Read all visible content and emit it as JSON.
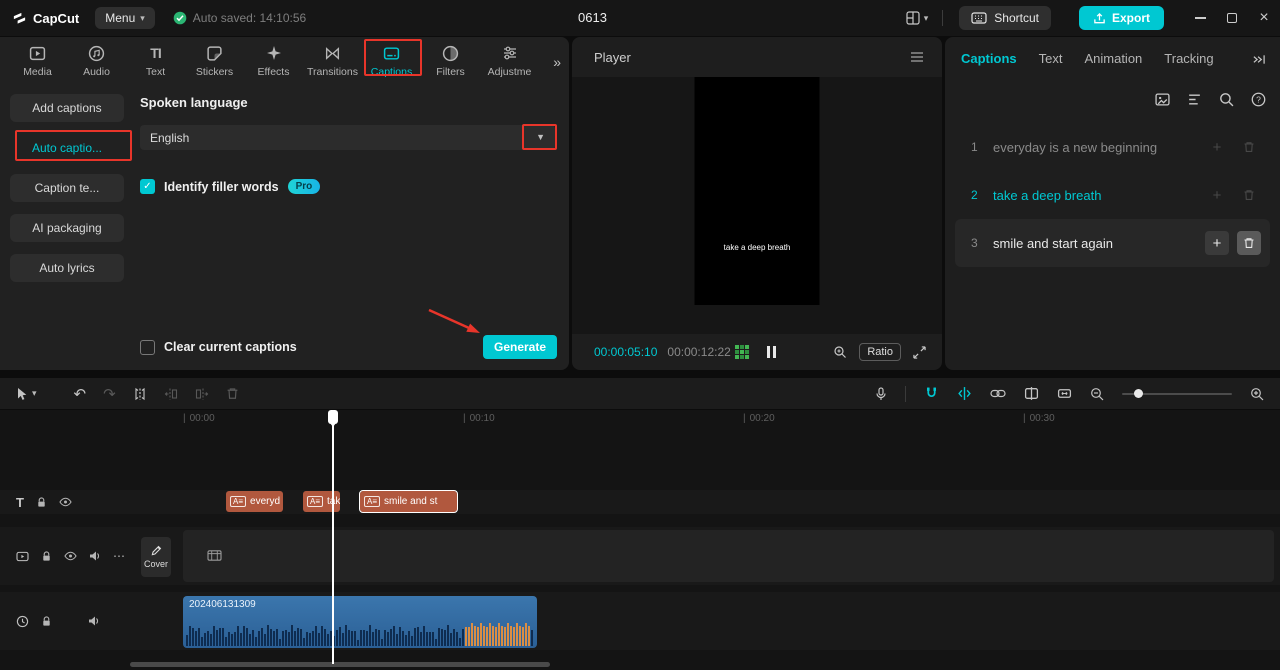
{
  "colors": {
    "accent": "#00c8d2",
    "annotation_red": "#e8352a",
    "caption_clip": "#b1583e",
    "audio_clip_blue": "#2f6398"
  },
  "titlebar": {
    "logo": "CapCut",
    "menu": "Menu",
    "autosave": "Auto saved: 14:10:56",
    "title": "0613",
    "shortcut": "Shortcut",
    "export": "Export"
  },
  "left_panel": {
    "tabs": [
      {
        "label": "Media"
      },
      {
        "label": "Audio"
      },
      {
        "label": "Text"
      },
      {
        "label": "Stickers"
      },
      {
        "label": "Effects"
      },
      {
        "label": "Transitions"
      },
      {
        "label": "Captions"
      },
      {
        "label": "Filters"
      },
      {
        "label": "Adjustme"
      }
    ],
    "sidebar": [
      "Add captions",
      "Auto captio...",
      "Caption te...",
      "AI packaging",
      "Auto lyrics"
    ],
    "spoken_language_label": "Spoken language",
    "language_value": "English",
    "filler_words_label": "Identify filler words",
    "pro_badge": "Pro",
    "clear_captions_label": "Clear current captions",
    "generate_button": "Generate"
  },
  "player": {
    "title": "Player",
    "caption_overlay": "take a deep breath",
    "current_time": "00:00:05:10",
    "total_time": "00:00:12:22",
    "ratio_button": "Ratio"
  },
  "right_panel": {
    "tabs": [
      "Captions",
      "Text",
      "Animation",
      "Tracking"
    ],
    "captions": [
      {
        "index": "1",
        "text": "everyday is a new beginning"
      },
      {
        "index": "2",
        "text": "take a deep breath"
      },
      {
        "index": "3",
        "text": "smile and start again"
      }
    ]
  },
  "timeline": {
    "ruler": [
      "00:00",
      "00:10",
      "00:20",
      "00:30"
    ],
    "cover": "Cover",
    "caption_clips": [
      "everyd",
      "tak",
      "smile and st"
    ],
    "audio_clip": "202406131309"
  }
}
